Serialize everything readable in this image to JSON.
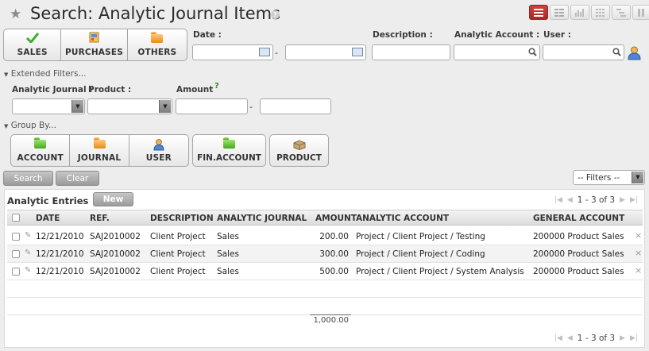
{
  "header": {
    "title": "Search: Analytic Journal Items",
    "help_glyph": "?",
    "views": [
      {
        "name": "list",
        "active": true
      },
      {
        "name": "form",
        "active": false
      },
      {
        "name": "graph",
        "active": false
      },
      {
        "name": "calendar",
        "active": false
      },
      {
        "name": "gantt",
        "active": false
      },
      {
        "name": "kanban",
        "active": false
      }
    ]
  },
  "filters": {
    "buttons": [
      {
        "label": "SALES",
        "icon": "checkmark-icon"
      },
      {
        "label": "PURCHASES",
        "icon": "purchases-icon"
      },
      {
        "label": "OTHERS",
        "icon": "folder-icon"
      }
    ],
    "date_label": "Date :",
    "date_separator": "-",
    "description_label": "Description :",
    "analytic_account_label": "Analytic Account :",
    "user_label": "User :"
  },
  "extended": {
    "toggle_label": "Extended Filters...",
    "analytic_journal_label": "Analytic Journal :",
    "product_label": "Product :",
    "amount_label": "Amount",
    "amount_help": "?",
    "amount_separator": "-"
  },
  "groupby": {
    "toggle_label": "Group By...",
    "buttons": [
      {
        "label": "ACCOUNT",
        "icon": "folder-icon"
      },
      {
        "label": "JOURNAL",
        "icon": "folder-icon"
      },
      {
        "label": "USER",
        "icon": "user-icon"
      },
      {
        "label": "FIN.ACCOUNT",
        "icon": "folder-icon"
      },
      {
        "label": "PRODUCT",
        "icon": "product-icon"
      }
    ]
  },
  "actions": {
    "search_label": "Search",
    "clear_label": "Clear",
    "filters_select": "-- Filters --"
  },
  "list": {
    "title": "Analytic Entries",
    "new_label": "New",
    "pager_text": "1 - 3 of 3",
    "columns": [
      "DATE",
      "REF.",
      "DESCRIPTION",
      "ANALYTIC JOURNAL",
      "AMOUNT",
      "ANALYTIC ACCOUNT",
      "GENERAL ACCOUNT"
    ],
    "rows": [
      {
        "date": "12/21/2010",
        "ref": "SAJ2010002",
        "description": "Client Project",
        "journal": "Sales",
        "amount": "200.00",
        "analytic_account": "Project / Client Project / Testing",
        "general_account": "200000 Product Sales"
      },
      {
        "date": "12/21/2010",
        "ref": "SAJ2010002",
        "description": "Client Project",
        "journal": "Sales",
        "amount": "300.00",
        "analytic_account": "Project / Client Project / Coding",
        "general_account": "200000 Product Sales"
      },
      {
        "date": "12/21/2010",
        "ref": "SAJ2010002",
        "description": "Client Project",
        "journal": "Sales",
        "amount": "500.00",
        "analytic_account": "Project / Client Project / System Analysis",
        "general_account": "200000 Product Sales"
      }
    ],
    "total": "1,000.00",
    "delete_glyph": "×"
  }
}
